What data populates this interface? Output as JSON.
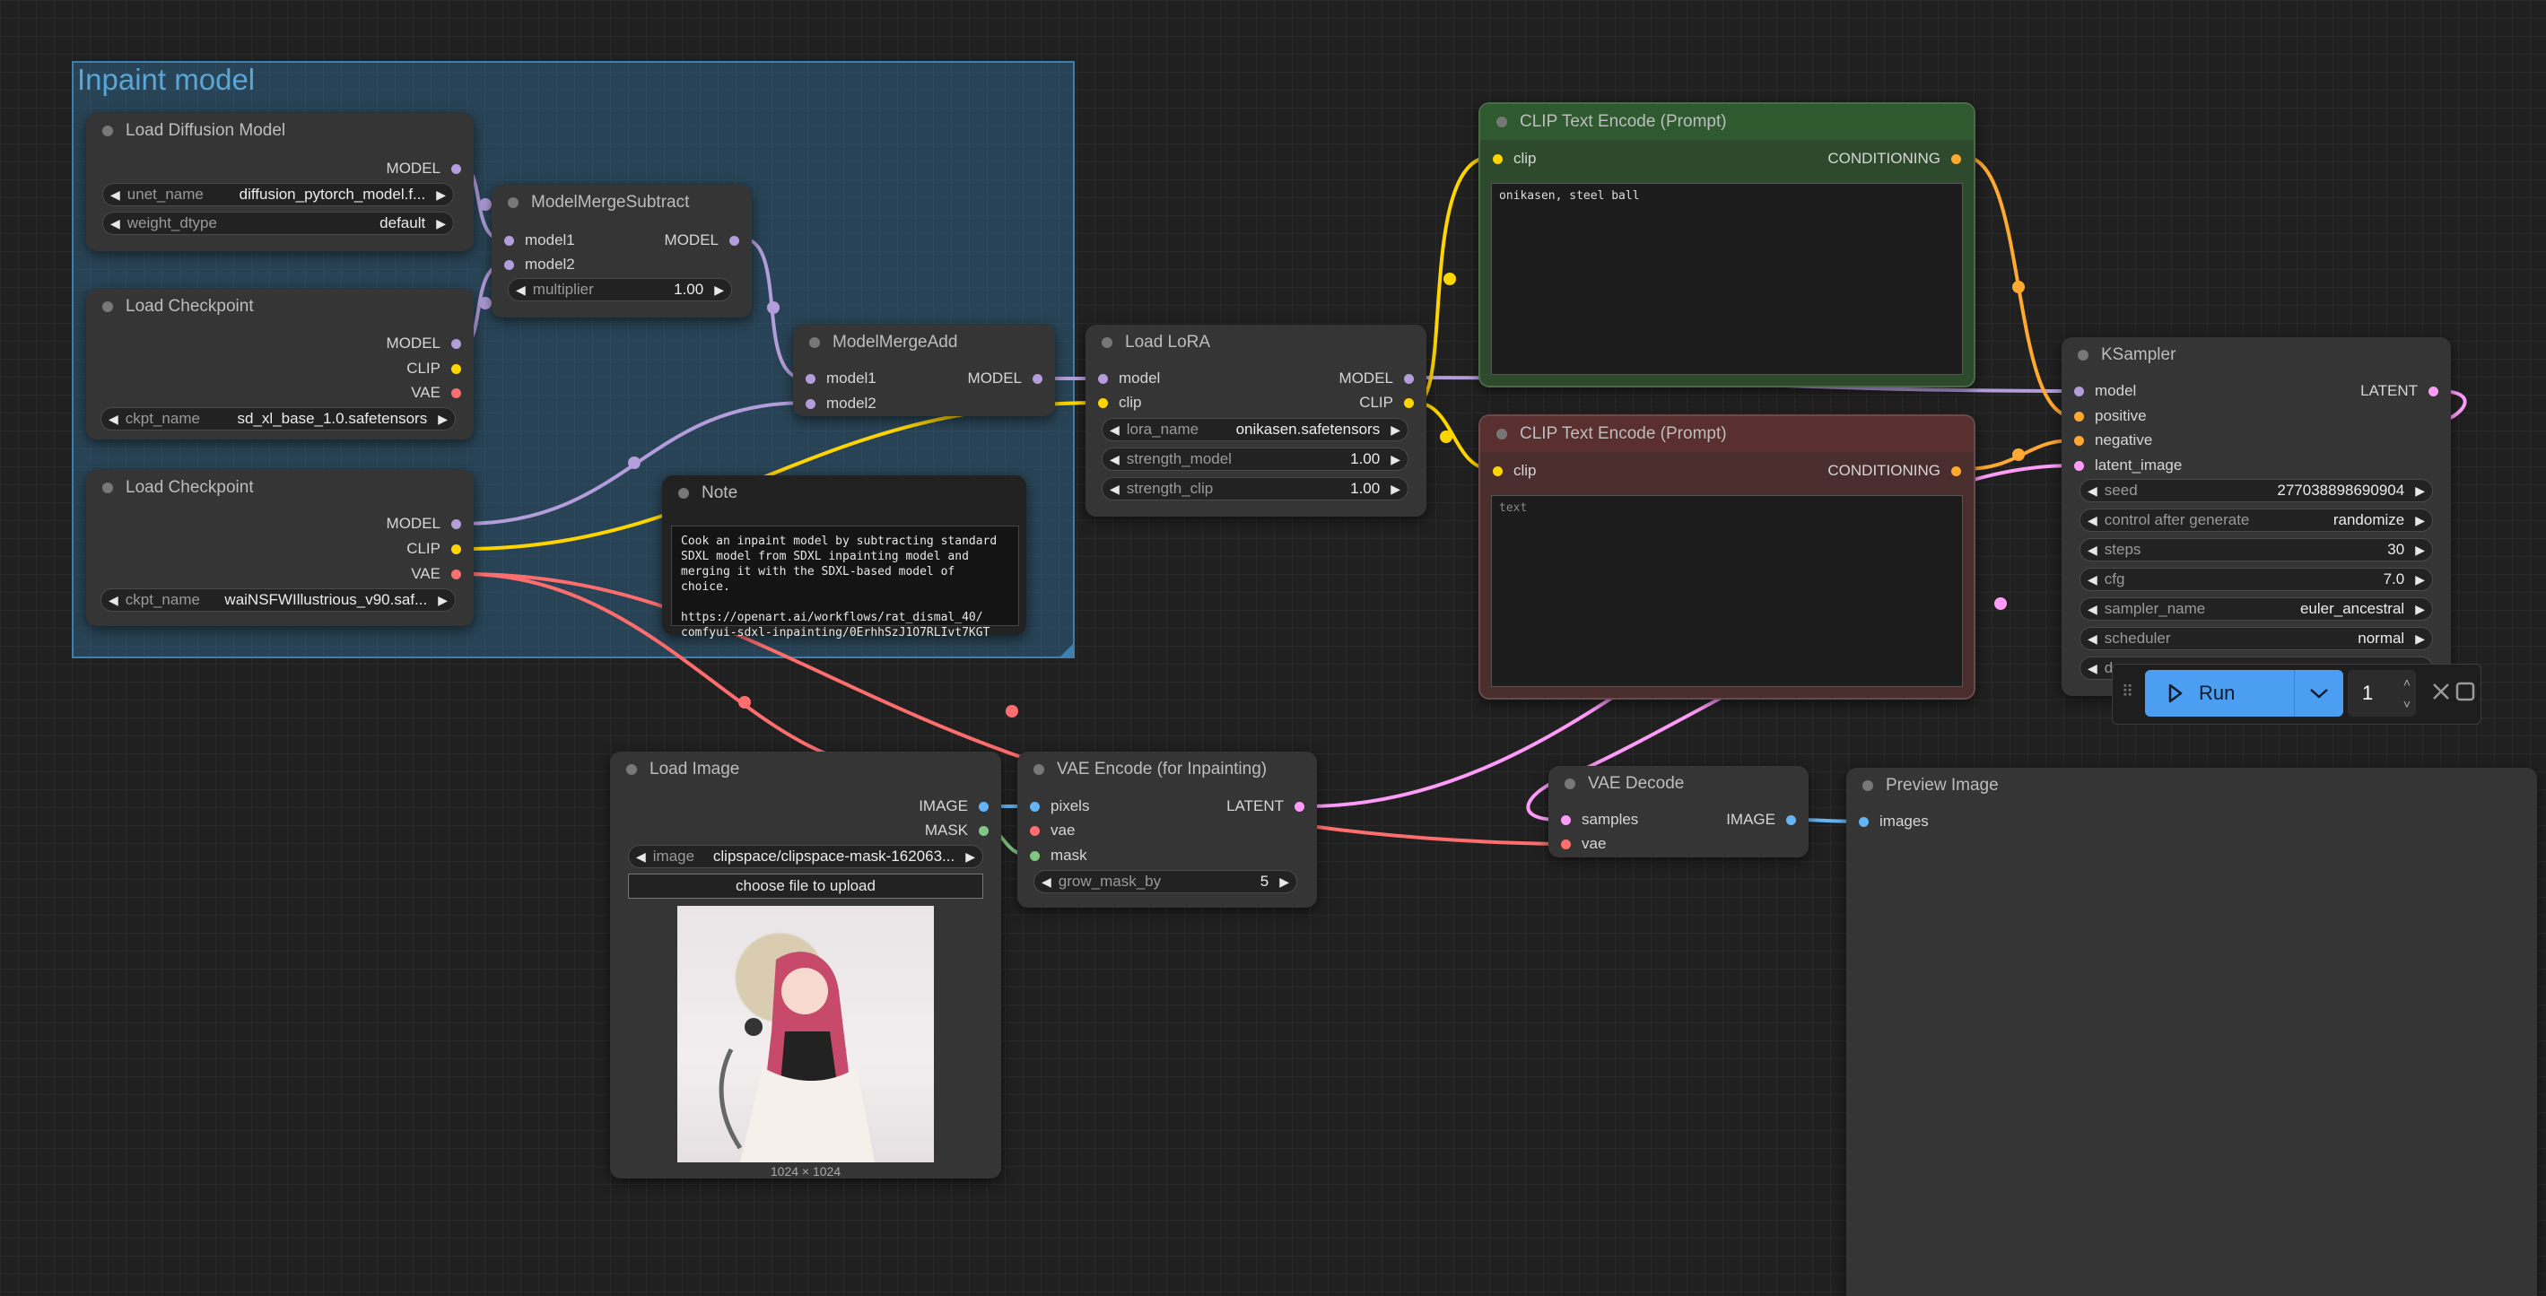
{
  "group": {
    "title": "Inpaint model"
  },
  "nodes": {
    "load_diffusion": {
      "title": "Load Diffusion Model",
      "outputs": [
        "MODEL"
      ],
      "widgets": [
        {
          "label": "unet_name",
          "value": "diffusion_pytorch_model.f..."
        },
        {
          "label": "weight_dtype",
          "value": "default"
        }
      ]
    },
    "load_checkpoint_1": {
      "title": "Load Checkpoint",
      "outputs": [
        "MODEL",
        "CLIP",
        "VAE"
      ],
      "widgets": [
        {
          "label": "ckpt_name",
          "value": "sd_xl_base_1.0.safetensors"
        }
      ]
    },
    "load_checkpoint_2": {
      "title": "Load Checkpoint",
      "outputs": [
        "MODEL",
        "CLIP",
        "VAE"
      ],
      "widgets": [
        {
          "label": "ckpt_name",
          "value": "waiNSFWIllustrious_v90.saf..."
        }
      ]
    },
    "merge_subtract": {
      "title": "ModelMergeSubtract",
      "inputs": [
        "model1",
        "model2"
      ],
      "outputs": [
        "MODEL"
      ],
      "widgets": [
        {
          "label": "multiplier",
          "value": "1.00"
        }
      ]
    },
    "merge_add": {
      "title": "ModelMergeAdd",
      "inputs": [
        "model1",
        "model2"
      ],
      "outputs": [
        "MODEL"
      ]
    },
    "note": {
      "title": "Note",
      "text": "Cook an inpaint model by subtracting standard\nSDXL model from SDXL inpainting model and\nmerging it with the SDXL-based model of choice.\n\nhttps://openart.ai/workflows/rat_dismal_40/\ncomfyui-sdxl-inpainting/0ErhhSzJ1O7RLIvt7KGT"
    },
    "load_lora": {
      "title": "Load LoRA",
      "inputs": [
        "model",
        "clip"
      ],
      "outputs": [
        "MODEL",
        "CLIP"
      ],
      "widgets": [
        {
          "label": "lora_name",
          "value": "onikasen.safetensors"
        },
        {
          "label": "strength_model",
          "value": "1.00"
        },
        {
          "label": "strength_clip",
          "value": "1.00"
        }
      ]
    },
    "clip_pos": {
      "title": "CLIP Text Encode (Prompt)",
      "inputs": [
        "clip"
      ],
      "outputs": [
        "CONDITIONING"
      ],
      "text": "onikasen, steel ball"
    },
    "clip_neg": {
      "title": "CLIP Text Encode (Prompt)",
      "inputs": [
        "clip"
      ],
      "outputs": [
        "CONDITIONING"
      ],
      "placeholder": "text"
    },
    "ksampler": {
      "title": "KSampler",
      "inputs": [
        "model",
        "positive",
        "negative",
        "latent_image"
      ],
      "outputs": [
        "LATENT"
      ],
      "widgets": [
        {
          "label": "seed",
          "value": "277038898690904"
        },
        {
          "label": "control after generate",
          "value": "randomize"
        },
        {
          "label": "steps",
          "value": "30"
        },
        {
          "label": "cfg",
          "value": "7.0"
        },
        {
          "label": "sampler_name",
          "value": "euler_ancestral"
        },
        {
          "label": "scheduler",
          "value": "normal"
        },
        {
          "label": "de",
          "value": ""
        }
      ]
    },
    "load_image": {
      "title": "Load Image",
      "outputs": [
        "IMAGE",
        "MASK"
      ],
      "widgets": [
        {
          "label": "image",
          "value": "clipspace/clipspace-mask-162063..."
        }
      ],
      "upload_label": "choose file to upload",
      "dimensions": "1024 × 1024"
    },
    "vae_encode": {
      "title": "VAE Encode (for Inpainting)",
      "inputs": [
        "pixels",
        "vae",
        "mask"
      ],
      "outputs": [
        "LATENT"
      ],
      "widgets": [
        {
          "label": "grow_mask_by",
          "value": "5"
        }
      ]
    },
    "vae_decode": {
      "title": "VAE Decode",
      "inputs": [
        "samples",
        "vae"
      ],
      "outputs": [
        "IMAGE"
      ]
    },
    "preview_image": {
      "title": "Preview Image",
      "inputs": [
        "images"
      ]
    }
  },
  "toolbar": {
    "run_label": "Run",
    "queue_count": "1"
  },
  "colors": {
    "model": "#b39ddb",
    "clip": "#ffd500",
    "vae": "#ff6e6e",
    "conditioning": "#ffa931",
    "latent": "#ff9cf9",
    "image": "#64b5f6",
    "mask": "#81c784",
    "clip_pos_bg": "#2d4a2d",
    "clip_pos_header": "#2f5a2f",
    "clip_neg_bg": "#4a2d2d",
    "clip_neg_header": "#5a2f2f"
  }
}
